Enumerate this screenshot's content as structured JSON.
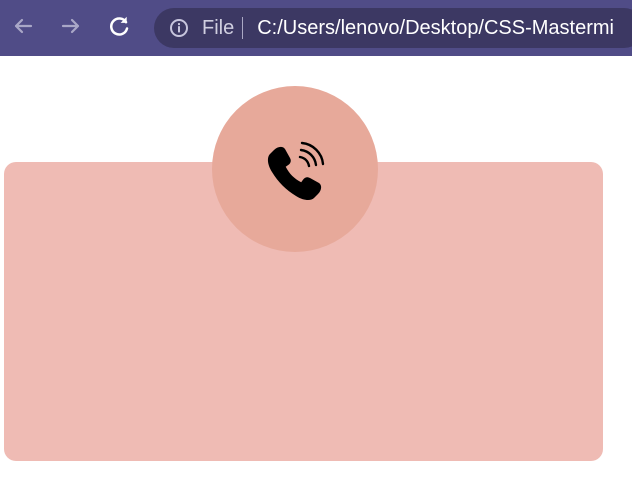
{
  "browser": {
    "scheme_label": "File",
    "url": "C:/Users/lenovo/Desktop/CSS-Mastermi",
    "icons": {
      "back": "arrow-left-icon",
      "forward": "arrow-right-icon",
      "reload": "reload-icon",
      "info": "info-icon"
    }
  },
  "page": {
    "card": {
      "icon": "phone-ringing-icon"
    }
  },
  "colors": {
    "toolbar": "#504c87",
    "address_bar": "#3c3863",
    "card": "#efbbb4",
    "icon_circle": "#e7a99a",
    "page": "#ffffff"
  }
}
